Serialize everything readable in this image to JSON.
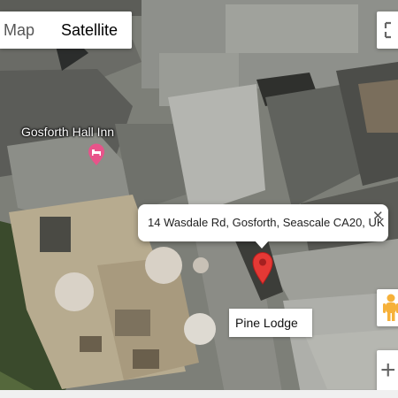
{
  "map_type": {
    "map_label": "Map",
    "satellite_label": "Satellite",
    "selected": "Satellite"
  },
  "poi": {
    "name": "Gosforth Hall Inn",
    "icon": "hotel-icon"
  },
  "info_window": {
    "address": "14 Wasdale Rd, Gosforth, Seascale CA20, UK",
    "close_symbol": "✕"
  },
  "marker": {
    "icon": "red-pin-icon",
    "color": "#e53935"
  },
  "place_label": "Pine Lodge",
  "controls": {
    "fullscreen_icon": "fullscreen-icon",
    "pegman_icon": "pegman-icon",
    "zoom_in_symbol": "+"
  },
  "colors": {
    "accent_poi": "#e8538a",
    "marker": "#e53935"
  }
}
